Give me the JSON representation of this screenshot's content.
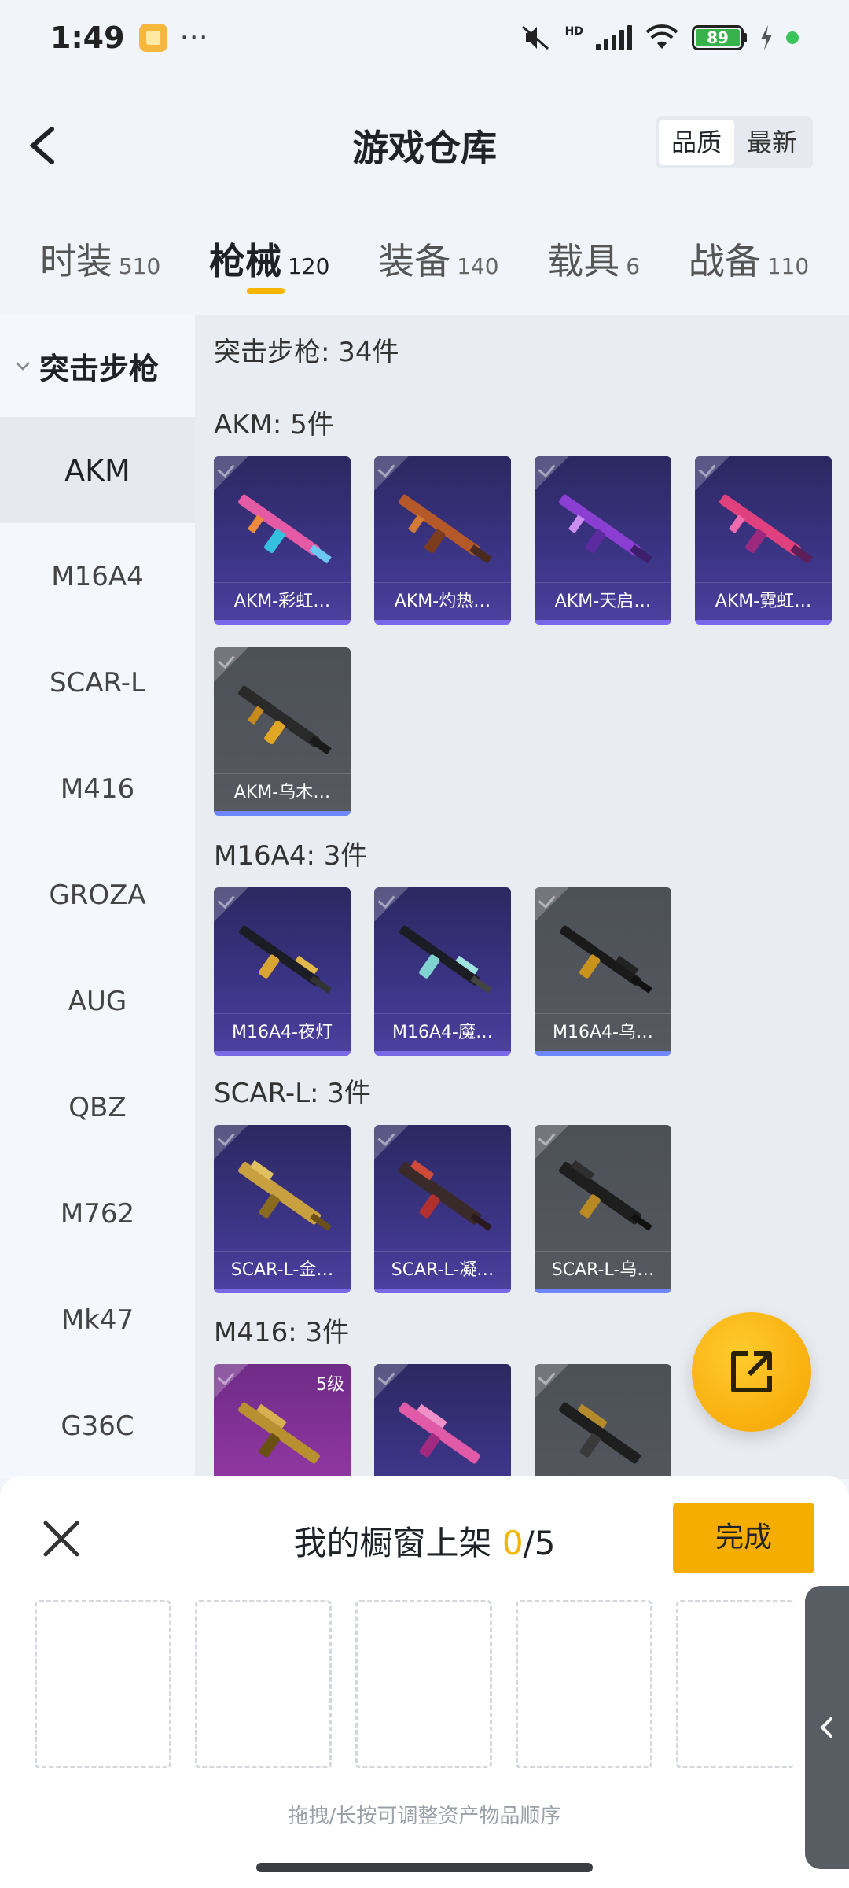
{
  "status_bar": {
    "time": "1:49",
    "dots": "···",
    "network": "HD",
    "battery": "89"
  },
  "header": {
    "title": "游戏仓库",
    "sort_quality": "品质",
    "sort_latest": "最新"
  },
  "tabs": [
    {
      "label": "时装",
      "count": "510"
    },
    {
      "label": "枪械",
      "count": "120"
    },
    {
      "label": "装备",
      "count": "140"
    },
    {
      "label": "载具",
      "count": "6"
    },
    {
      "label": "战备",
      "count": "110"
    }
  ],
  "sidebar": {
    "category": "突击步枪",
    "items": [
      "AKM",
      "M16A4",
      "SCAR-L",
      "M416",
      "GROZA",
      "AUG",
      "QBZ",
      "M762",
      "Mk47",
      "G36C"
    ]
  },
  "content": {
    "summary": "突击步枪: 34件",
    "groups": [
      {
        "title": "AKM: 5件",
        "items": [
          "AKM-彩虹…",
          "AKM-灼热…",
          "AKM-天启…",
          "AKM-霓虹…",
          "AKM-乌木…"
        ]
      },
      {
        "title": "M16A4: 3件",
        "items": [
          "M16A4-夜灯",
          "M16A4-魔…",
          "M16A4-乌…"
        ]
      },
      {
        "title": "SCAR-L: 3件",
        "items": [
          "SCAR-L-金…",
          "SCAR-L-凝…",
          "SCAR-L-乌…"
        ]
      },
      {
        "title": "M416: 3件",
        "level_badge": "5级"
      }
    ]
  },
  "sheet": {
    "title_prefix": "我的橱窗上架 ",
    "current": "0",
    "total": "/5",
    "done_label": "完成",
    "hint": "拖拽/长按可调整资产物品顺序"
  },
  "colors": {
    "accent": "#f5b400",
    "purple_card": "#3a3382",
    "gray_card": "#56595f"
  }
}
